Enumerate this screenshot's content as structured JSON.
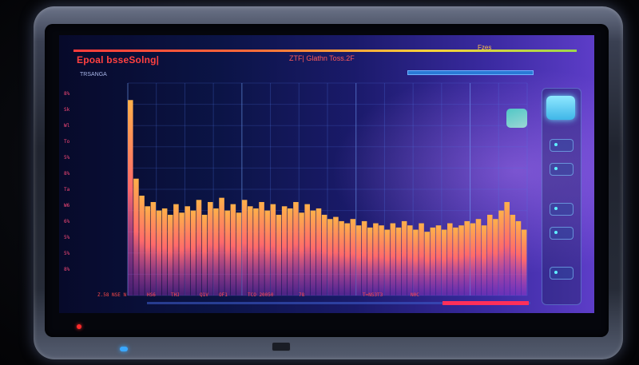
{
  "app": {
    "title": "Epoal bsseSolng|",
    "header_info": "ZTF| Glathn Toss.2F",
    "top_right_label": "Fzes",
    "mode_label": "TRSANGA"
  },
  "left_readout": [
    "8%",
    "Sk",
    "Wl",
    "To",
    "5%",
    "8%",
    "Ta",
    "W6",
    "6%",
    "5%",
    "5%",
    "8%"
  ],
  "bottom_readout": [
    "Z.58 NSE N",
    "HS6",
    "THJ",
    "Q1V",
    "OF1",
    "TCO 20050",
    "78",
    "T=NS3T3",
    "N0C"
  ],
  "colors": {
    "accent_red": "#ff4040",
    "spectrum_orange": "#ff9a3c",
    "spectrum_magenta": "#d64ad8",
    "grid_blue": "#3c78ff"
  },
  "icons": {
    "main_button": "display-icon",
    "square_button": "tile-icon"
  },
  "chart_data": {
    "type": "bar",
    "title": "",
    "xlabel": "",
    "ylabel": "",
    "ylim": [
      0,
      100
    ],
    "values": [
      92,
      55,
      47,
      42,
      44,
      40,
      41,
      38,
      43,
      39,
      42,
      40,
      45,
      38,
      44,
      41,
      46,
      40,
      43,
      39,
      45,
      42,
      41,
      44,
      40,
      43,
      38,
      42,
      41,
      44,
      39,
      43,
      40,
      41,
      38,
      36,
      37,
      35,
      34,
      36,
      33,
      35,
      32,
      34,
      33,
      31,
      34,
      32,
      35,
      33,
      31,
      34,
      30,
      32,
      33,
      31,
      34,
      32,
      33,
      35,
      34,
      36,
      33,
      38,
      36,
      40,
      44,
      38,
      35,
      31
    ]
  }
}
